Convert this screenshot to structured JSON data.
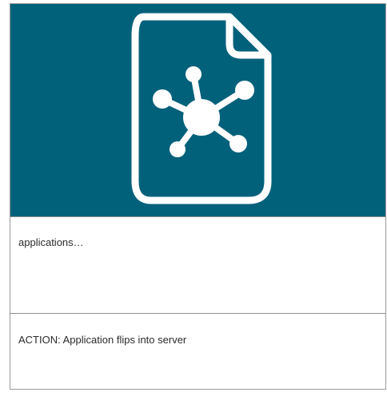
{
  "colors": {
    "hero_background": "#02617a",
    "icon_stroke": "#ffffff"
  },
  "hero": {
    "icon": "network-document-icon"
  },
  "caption": {
    "text": "applications…"
  },
  "action": {
    "text": "ACTION: Application flips into server"
  }
}
